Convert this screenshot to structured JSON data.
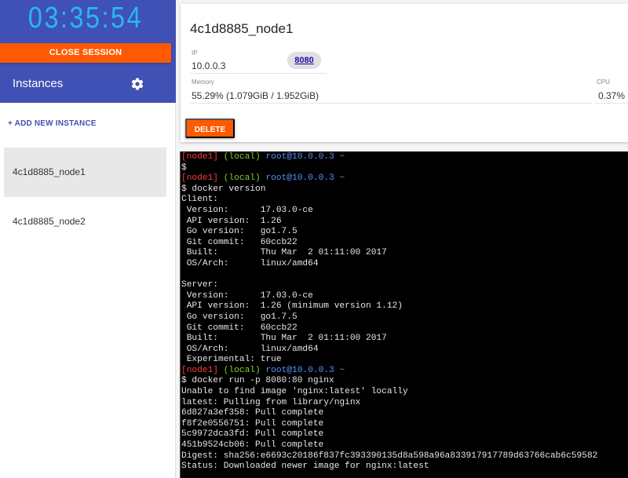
{
  "sidebar": {
    "timer": "03:35:54",
    "close_session_label": "CLOSE SESSION",
    "instances_title": "Instances",
    "settings_icon": "gear-icon",
    "add_instance_label": "+ ADD NEW INSTANCE",
    "instances": [
      {
        "name": "4c1d8885_node1",
        "active": true
      },
      {
        "name": "4c1d8885_node2",
        "active": false
      }
    ]
  },
  "instance_card": {
    "title": "4c1d8885_node1",
    "ip_label": "IP",
    "ip_value": "10.0.0.3",
    "port_chip": "8080",
    "memory_label": "Memory",
    "memory_value": "55.29% (1.079GiB / 1.952GiB)",
    "cpu_label": "CPU",
    "cpu_value": "0.37%",
    "delete_label": "DELETE"
  },
  "colors": {
    "header_bg": "#3f51b5",
    "timer": "#29b6f6",
    "accent_orange": "#ff5a00",
    "link": "#1a0dab",
    "terminal_bg": "#000000"
  },
  "terminal": {
    "prompt": {
      "node": "[node1]",
      "local": "(local)",
      "host": "root@10.0.0.3 ~"
    },
    "lines": [
      {
        "type": "prompt"
      },
      {
        "type": "text",
        "text": "$"
      },
      {
        "type": "prompt"
      },
      {
        "type": "text",
        "text": "$ docker version"
      },
      {
        "type": "text",
        "text": "Client:"
      },
      {
        "type": "text",
        "text": " Version:      17.03.0-ce"
      },
      {
        "type": "text",
        "text": " API version:  1.26"
      },
      {
        "type": "text",
        "text": " Go version:   go1.7.5"
      },
      {
        "type": "text",
        "text": " Git commit:   60ccb22"
      },
      {
        "type": "text",
        "text": " Built:        Thu Mar  2 01:11:00 2017"
      },
      {
        "type": "text",
        "text": " OS/Arch:      linux/amd64"
      },
      {
        "type": "text",
        "text": ""
      },
      {
        "type": "text",
        "text": "Server:"
      },
      {
        "type": "text",
        "text": " Version:      17.03.0-ce"
      },
      {
        "type": "text",
        "text": " API version:  1.26 (minimum version 1.12)"
      },
      {
        "type": "text",
        "text": " Go version:   go1.7.5"
      },
      {
        "type": "text",
        "text": " Git commit:   60ccb22"
      },
      {
        "type": "text",
        "text": " Built:        Thu Mar  2 01:11:00 2017"
      },
      {
        "type": "text",
        "text": " OS/Arch:      linux/amd64"
      },
      {
        "type": "text",
        "text": " Experimental: true"
      },
      {
        "type": "prompt"
      },
      {
        "type": "text",
        "text": "$ docker run -p 8080:80 nginx"
      },
      {
        "type": "text",
        "text": "Unable to find image 'nginx:latest' locally"
      },
      {
        "type": "text",
        "text": "latest: Pulling from library/nginx"
      },
      {
        "type": "text",
        "text": "6d827a3ef358: Pull complete"
      },
      {
        "type": "text",
        "text": "f8f2e0556751: Pull complete"
      },
      {
        "type": "text",
        "text": "5c9972dca3fd: Pull complete"
      },
      {
        "type": "text",
        "text": "451b9524cb06: Pull complete"
      },
      {
        "type": "text",
        "text": "Digest: sha256:e6693c20186f837fc393390135d8a598a96a833917917789d63766cab6c59582"
      },
      {
        "type": "text",
        "text": "Status: Downloaded newer image for nginx:latest"
      }
    ]
  }
}
